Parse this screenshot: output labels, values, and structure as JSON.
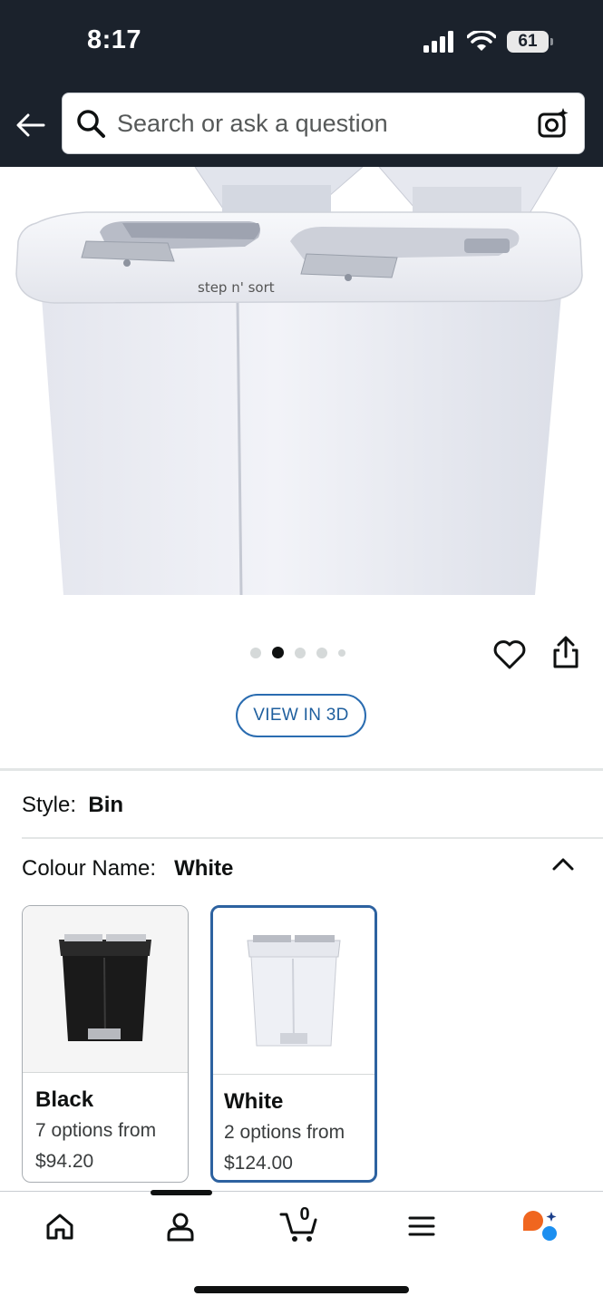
{
  "status": {
    "time": "8:17",
    "battery": "61",
    "icons": [
      "signal-icon",
      "wifi-icon",
      "battery-icon"
    ]
  },
  "search": {
    "placeholder": "Search or ask a question",
    "icons": [
      "back-arrow-icon",
      "search-icon",
      "camera-icon"
    ]
  },
  "gallery": {
    "image_count": 5,
    "active_index": 1,
    "brand_text": "step n' sort"
  },
  "actions": {
    "view_3d_label": "VIEW IN 3D"
  },
  "style": {
    "label": "Style:",
    "value": "Bin"
  },
  "colour": {
    "label": "Colour Name:",
    "value": "White",
    "options": [
      {
        "name": "Black",
        "options_text": "7 options from",
        "price": "$94.20",
        "selected": false
      },
      {
        "name": "White",
        "options_text": "2 options from",
        "price": "$124.00",
        "selected": true
      }
    ]
  },
  "nav": {
    "cart_count": "0",
    "items": [
      "home-icon",
      "account-icon",
      "cart-icon",
      "menu-icon",
      "ai-assistant-icon"
    ]
  },
  "colors": {
    "header_bg": "#1b222c",
    "link_blue": "#2a6cb0",
    "selected_border": "#2d62a0"
  }
}
